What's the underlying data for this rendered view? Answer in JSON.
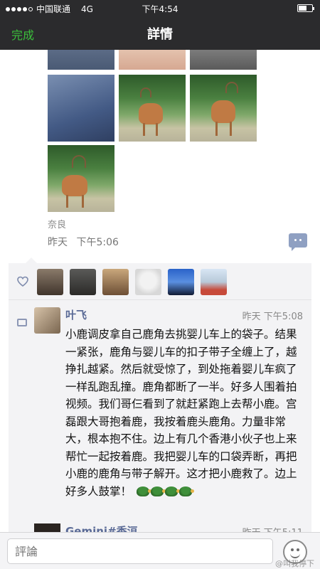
{
  "status_bar": {
    "carrier": "中国联通",
    "network": "4G",
    "time": "下午4:54",
    "battery_level": 0.6
  },
  "nav": {
    "done_label": "完成",
    "title": "詳情"
  },
  "post": {
    "location": "奈良",
    "day": "昨天",
    "time": "下午5:06"
  },
  "likes": {
    "icon": "heart-icon",
    "avatar_count": 6
  },
  "comments": [
    {
      "name": "叶飞",
      "timestamp": "昨天  下午5:08",
      "text": "小鹿调皮拿自己鹿角去挑婴儿车上的袋子。结果一紧张，鹿角与婴儿车的扣子带子全缠上了，越挣扎越紧。然后就受惊了，到处拖着婴儿车疯了一样乱跑乱撞。鹿角都断了一半。好多人围着拍视频。我们哥仨看到了就赶紧跑上去帮小鹿。宫磊跟大哥抱着鹿，我按着鹿头鹿角。力量非常大，根本抱不住。边上有几个香港小伙子也上来帮忙一起按着鹿。我把婴儿车的口袋弄断，再把小鹿的鹿角与带子解开。这才把小鹿救了。边上好多人鼓掌！",
      "emoji": "turtle"
    },
    {
      "name": "Gemini#香洹",
      "timestamp": "昨天  下午5:11"
    }
  ],
  "input": {
    "placeholder": "評論"
  },
  "watermark": "@叫我停下"
}
